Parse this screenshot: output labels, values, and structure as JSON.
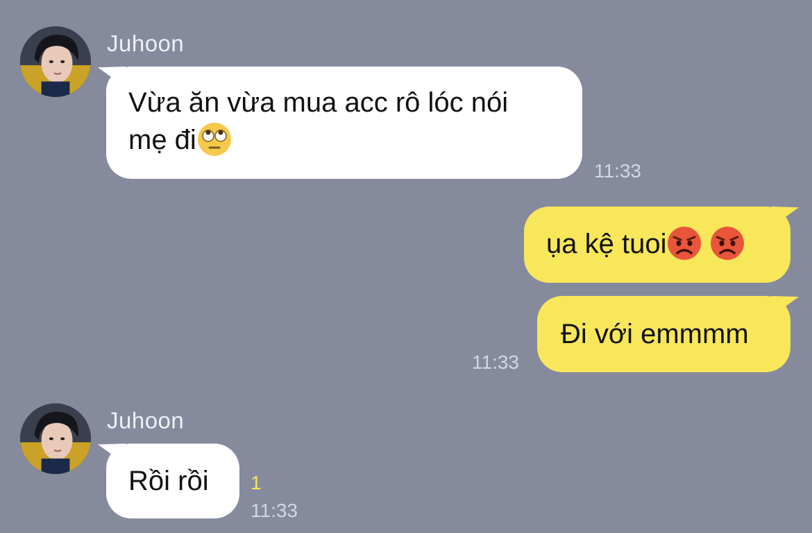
{
  "chat": {
    "messages": [
      {
        "sender": "Juhoon",
        "text_line1": "Vừa ăn vừa mua acc rô lóc nói",
        "text_line2": "mẹ đi",
        "emoji": "face-with-rolling-eyes-icon",
        "time": "11:33"
      },
      {
        "text": "ụa kệ tuoi",
        "emojis": [
          "pouting-face-icon",
          "pouting-face-icon"
        ]
      },
      {
        "text": "Đi với emmmm",
        "time": "11:33"
      },
      {
        "sender": "Juhoon",
        "text": "Rồi rồi",
        "unread": "1",
        "time": "11:33"
      }
    ]
  },
  "colors": {
    "background": "#858b9d",
    "incoming_bubble": "#ffffff",
    "outgoing_bubble": "#f8e75a",
    "unread_count": "#f8e75a"
  }
}
